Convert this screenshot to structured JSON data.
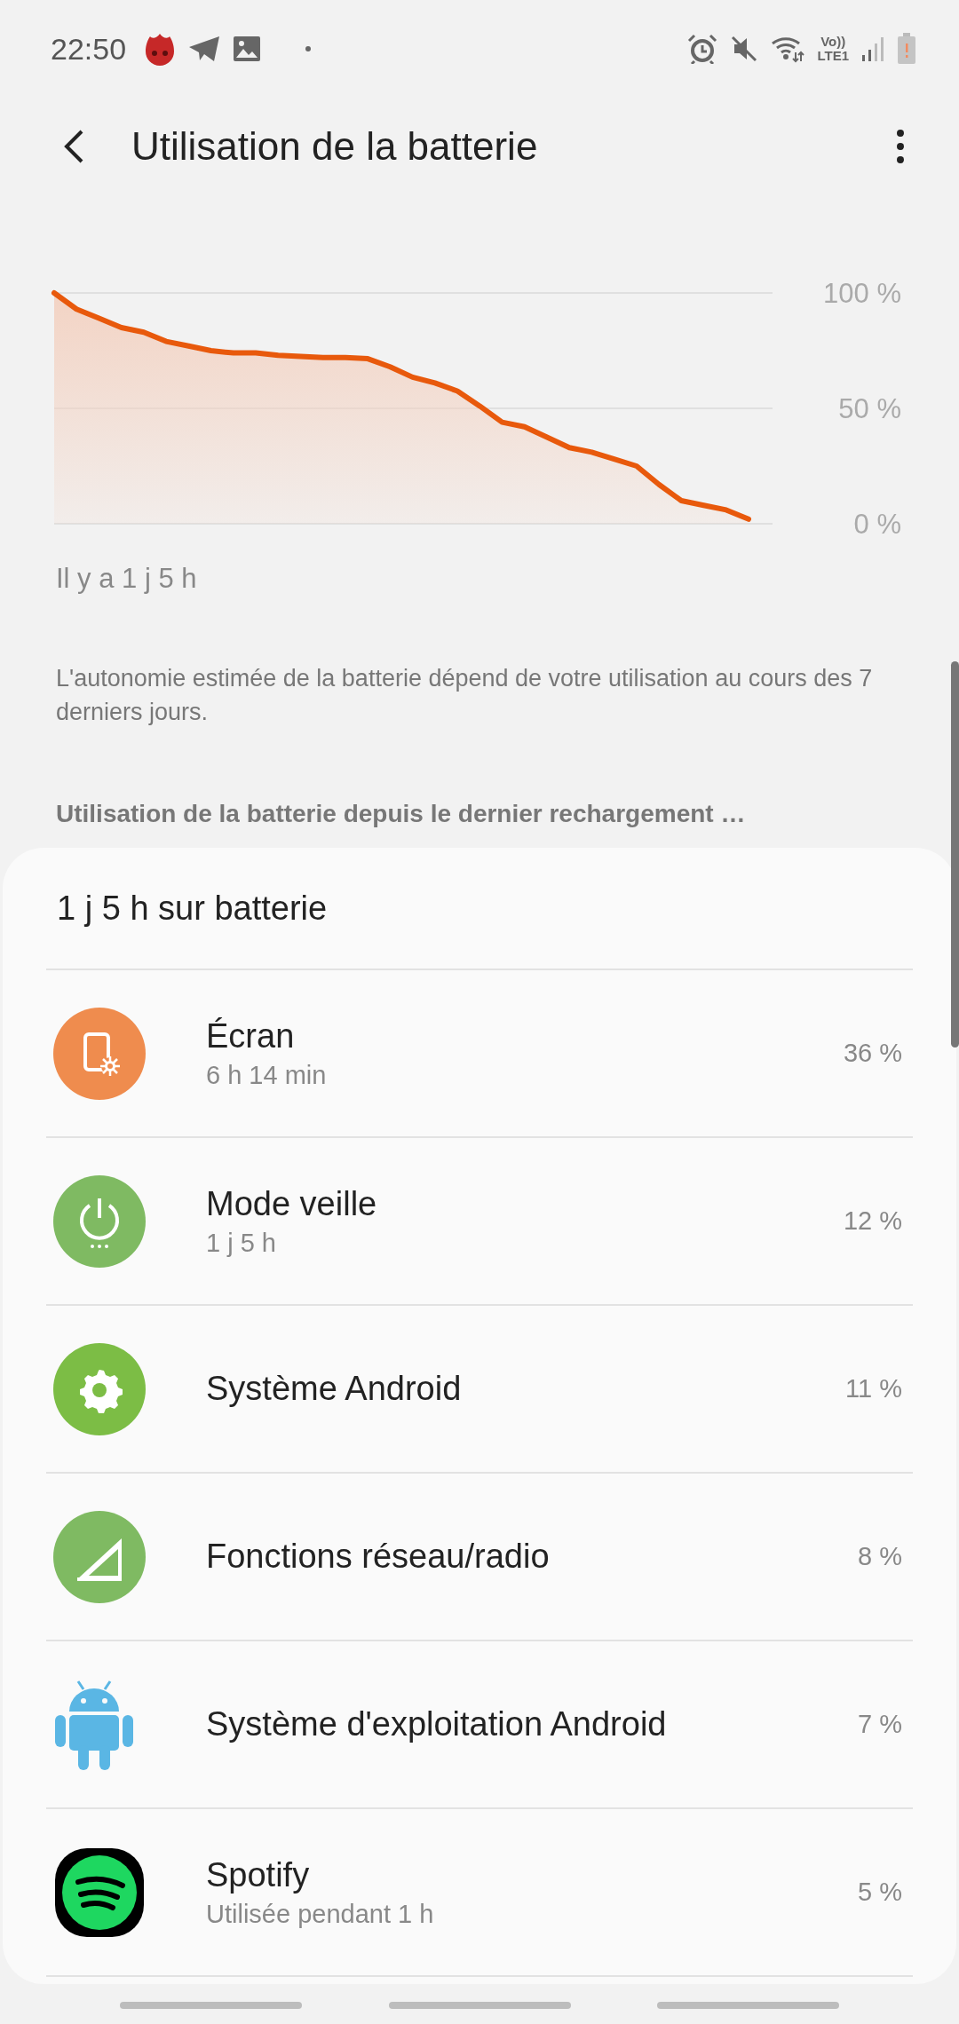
{
  "status_bar": {
    "time": "22:50",
    "vo_label": "Vo))",
    "lte_label": "LTE1"
  },
  "app_bar": {
    "title": "Utilisation de la batterie"
  },
  "chart_data": {
    "type": "area",
    "ylim": [
      0,
      100
    ],
    "yticks": [
      {
        "value": 100,
        "label": "100 %"
      },
      {
        "value": 50,
        "label": "50 %"
      },
      {
        "value": 0,
        "label": "0 %"
      }
    ],
    "annotations": [
      {
        "text": "Il y a 1 j 5 h"
      }
    ],
    "series": [
      {
        "color": "#e8590c",
        "values": [
          100,
          93,
          89,
          85,
          83,
          79,
          77,
          75,
          74,
          74,
          73,
          72.5,
          72,
          72,
          71.5,
          68,
          63.5,
          61,
          57.5,
          51,
          44,
          42,
          37.5,
          33,
          31,
          28,
          25,
          17,
          10,
          8,
          6,
          2
        ]
      }
    ]
  },
  "info_text": "L'autonomie estimée de la batterie dépend de votre utilisation au cours des 7 derniers jours.",
  "section_header": "Utilisation de la batterie depuis le dernier rechargement …",
  "usage": {
    "summary": "1 j 5 h sur batterie",
    "items": [
      {
        "kind": "screen",
        "name": "Écran",
        "detail": "6 h 14 min",
        "percent": "36 %"
      },
      {
        "kind": "standby",
        "name": "Mode veille",
        "detail": "1 j 5 h",
        "percent": "12 %"
      },
      {
        "kind": "system",
        "name": "Système Android",
        "percent": "11 %"
      },
      {
        "kind": "network",
        "name": "Fonctions réseau/radio",
        "percent": "8 %"
      },
      {
        "kind": "os",
        "name": "Système d'exploitation Android",
        "percent": "7 %"
      },
      {
        "kind": "app",
        "name": "Spotify",
        "detail": "Utilisée pendant 1 h",
        "percent": "5 %"
      }
    ]
  }
}
